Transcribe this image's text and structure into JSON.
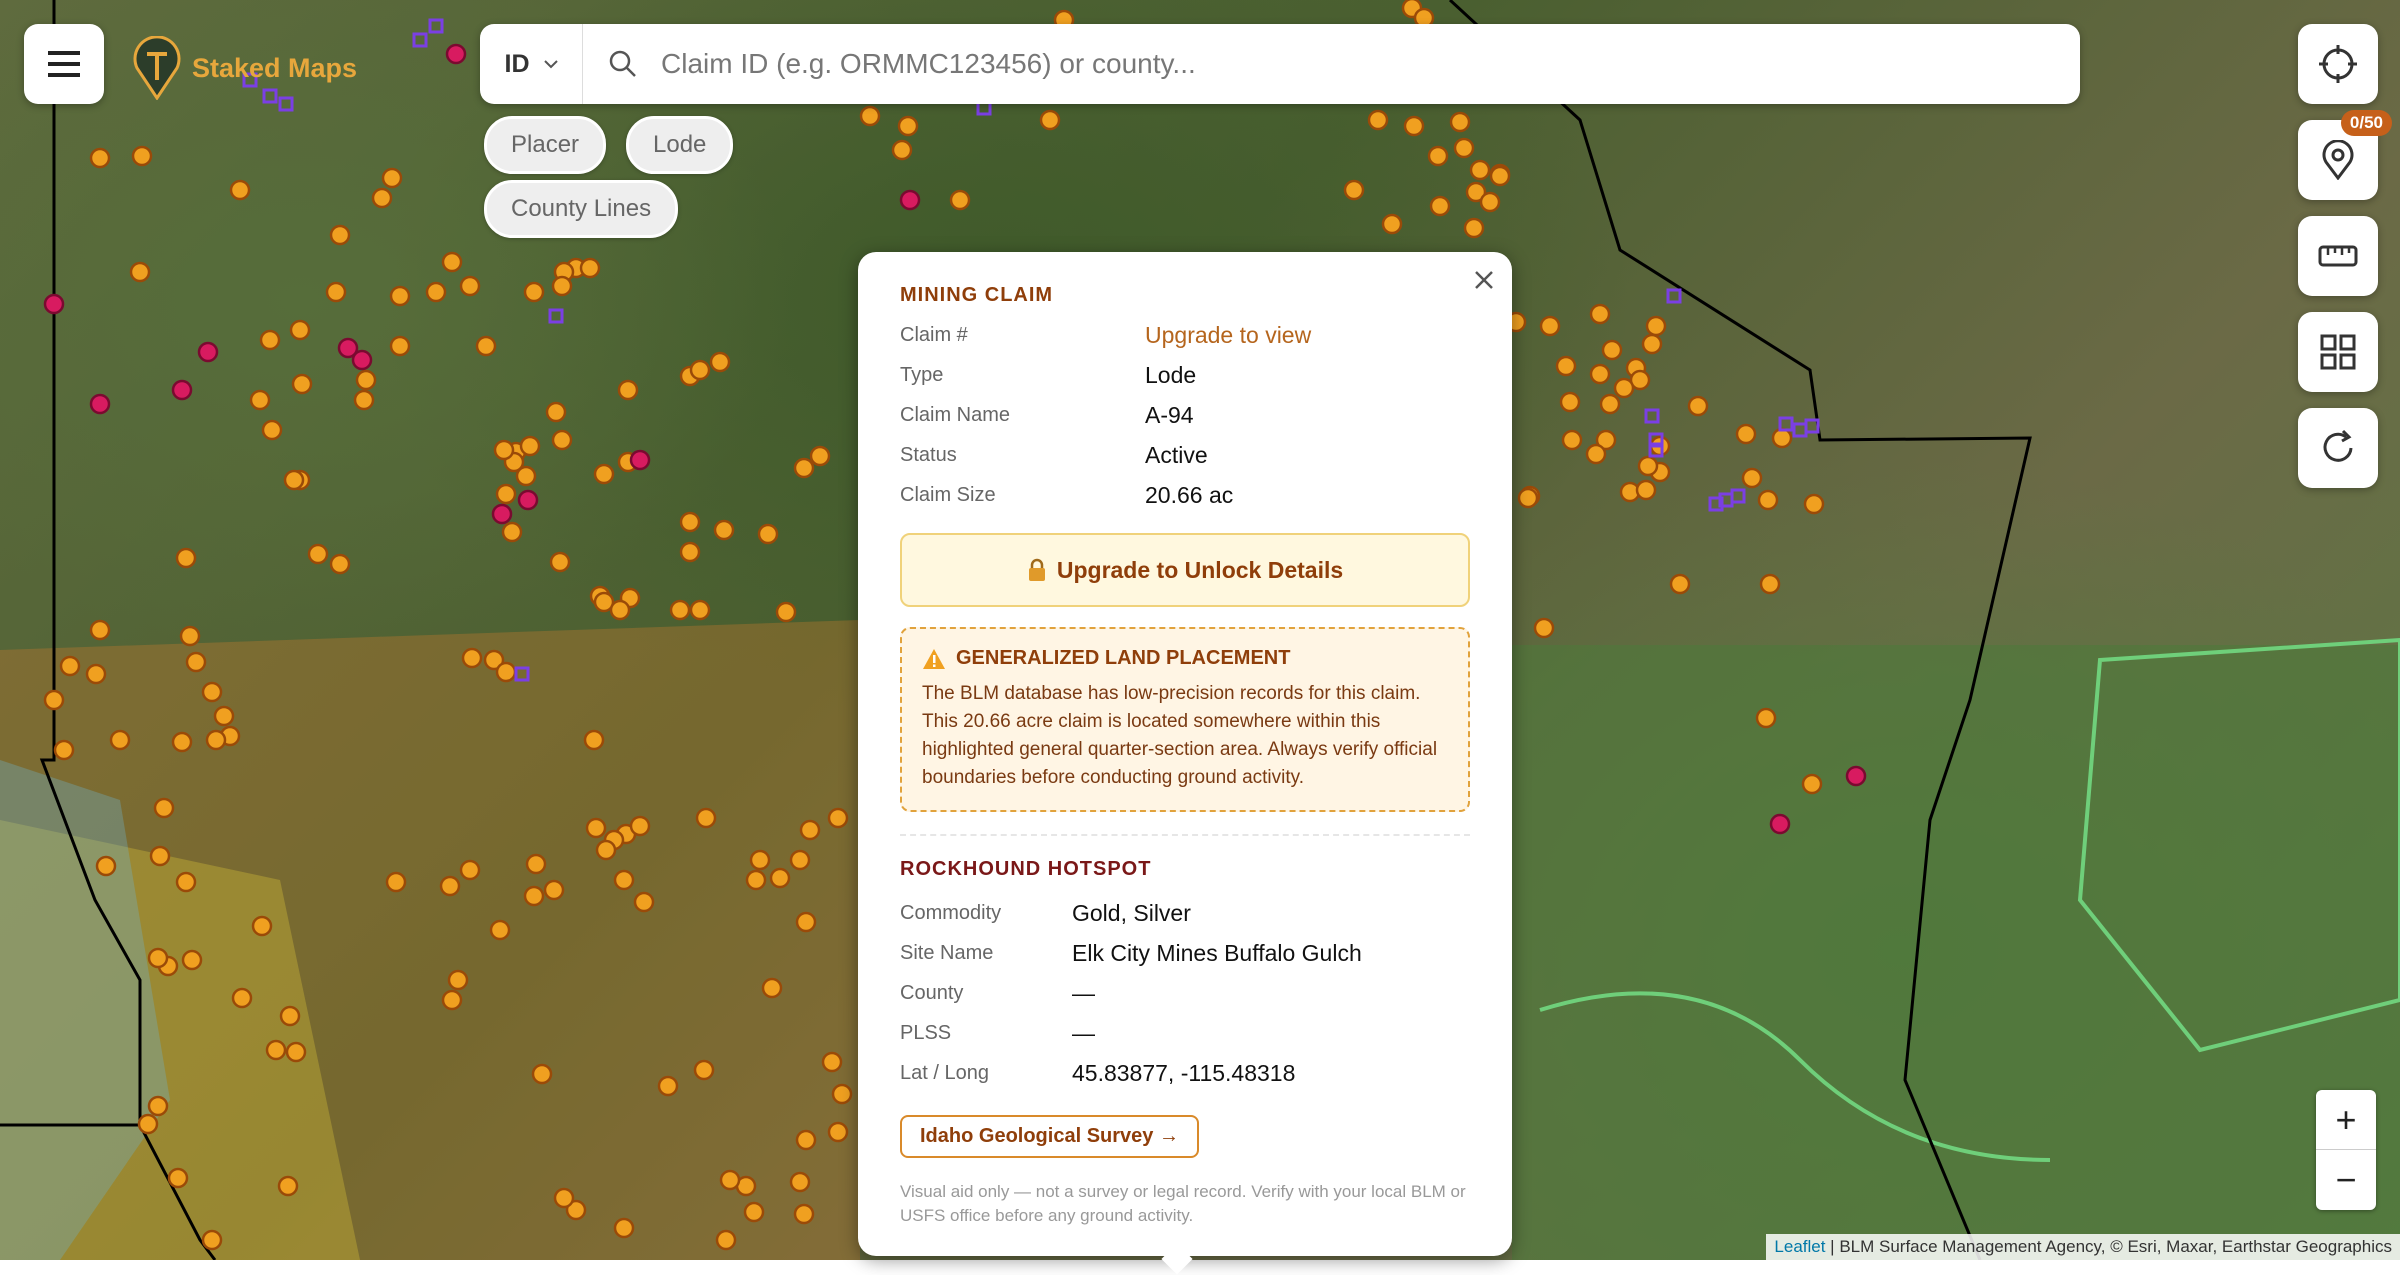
{
  "app": {
    "name": "Staked Maps",
    "brand_color": "#e7a73c"
  },
  "search": {
    "state": "ID",
    "placeholder": "Claim ID (e.g. ORMMC123456) or county..."
  },
  "filters": {
    "chips": [
      "Placer",
      "Lode",
      "County Lines"
    ]
  },
  "right_controls": {
    "locate_icon": "crosshair-icon",
    "pin_icon": "map-pin-icon",
    "pin_badge": "0/50",
    "measure_icon": "ruler-icon",
    "layers_icon": "grid-icon",
    "refresh_icon": "refresh-icon"
  },
  "zoom": {
    "in": "+",
    "out": "−"
  },
  "attribution": {
    "link": "Leaflet",
    "text": " | BLM Surface Management Agency, © Esri, Maxar, Earthstar Geographics"
  },
  "popup": {
    "claim_section": {
      "title": "MINING CLAIM",
      "rows": [
        {
          "label": "Claim #",
          "value": "Upgrade to view"
        },
        {
          "label": "Type",
          "value": "Lode"
        },
        {
          "label": "Claim Name",
          "value": "A-94"
        },
        {
          "label": "Status",
          "value": "Active"
        },
        {
          "label": "Claim Size",
          "value": "20.66 ac"
        }
      ],
      "upgrade_button": "Upgrade to Unlock Details"
    },
    "warning": {
      "title": "GENERALIZED LAND PLACEMENT",
      "body": "The BLM database has low-precision records for this claim. This 20.66 acre claim is located somewhere within this highlighted general quarter-section area. Always verify official boundaries before conducting ground activity."
    },
    "hotspot_section": {
      "title": "ROCKHOUND HOTSPOT",
      "rows": [
        {
          "label": "Commodity",
          "value": "Gold, Silver"
        },
        {
          "label": "Site Name",
          "value": "Elk City Mines Buffalo Gulch"
        },
        {
          "label": "County",
          "value": "—"
        },
        {
          "label": "PLSS",
          "value": "—"
        },
        {
          "label": "Lat / Long",
          "value": "45.83877, -115.48318"
        }
      ],
      "link": "Idaho Geological Survey →"
    },
    "disclaimer": "Visual aid only — not a survey or legal record. Verify with your local BLM or USFS office before any ground activity."
  },
  "map_colors": {
    "claim_marker": "#f0a020",
    "hotspot_marker": "#d81b60",
    "county_line": "#000000",
    "boundary_overlay": "#6fcf7a"
  }
}
